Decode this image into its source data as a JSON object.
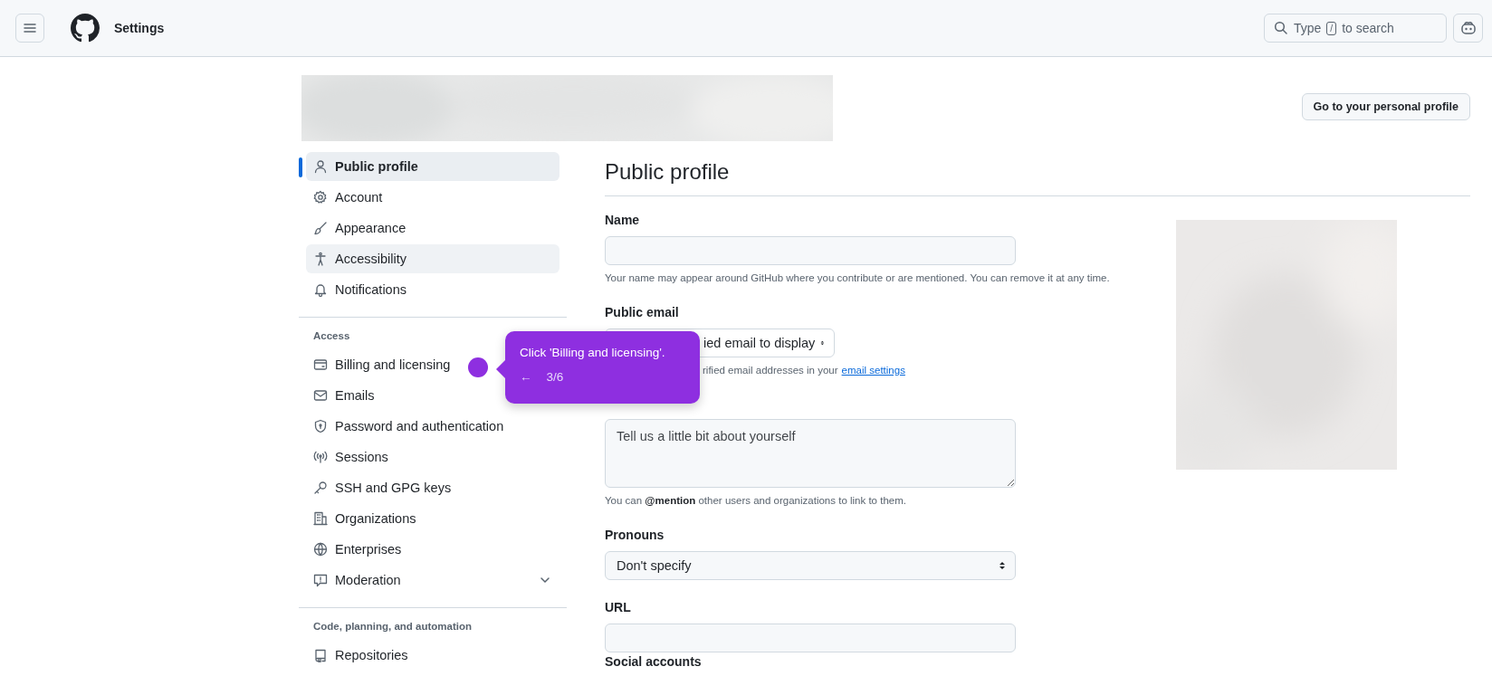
{
  "header": {
    "title": "Settings",
    "search": {
      "before": "Type",
      "key": "/",
      "after": "to search"
    }
  },
  "profile_button": "Go to your personal profile",
  "sidebar": {
    "sections": [
      {
        "items": [
          {
            "label": "Public profile",
            "selected": true,
            "hovered": false
          },
          {
            "label": "Account",
            "selected": false,
            "hovered": false
          },
          {
            "label": "Appearance",
            "selected": false,
            "hovered": false
          },
          {
            "label": "Accessibility",
            "selected": false,
            "hovered": true
          },
          {
            "label": "Notifications",
            "selected": false,
            "hovered": false
          }
        ]
      },
      {
        "heading": "Access",
        "items": [
          {
            "label": "Billing and licensing",
            "selected": false,
            "hovered": false
          },
          {
            "label": "Emails",
            "selected": false,
            "hovered": false
          },
          {
            "label": "Password and authentication",
            "selected": false,
            "hovered": false
          },
          {
            "label": "Sessions",
            "selected": false,
            "hovered": false
          },
          {
            "label": "SSH and GPG keys",
            "selected": false,
            "hovered": false
          },
          {
            "label": "Organizations",
            "selected": false,
            "hovered": false
          },
          {
            "label": "Enterprises",
            "selected": false,
            "hovered": false
          },
          {
            "label": "Moderation",
            "selected": false,
            "hovered": false,
            "expanded": false
          }
        ]
      },
      {
        "heading": "Code, planning, and automation",
        "items": [
          {
            "label": "Repositories",
            "selected": false,
            "hovered": false
          }
        ]
      }
    ]
  },
  "main": {
    "title": "Public profile",
    "name": {
      "label": "Name",
      "hint": "Your name may appear around GitHub where you contribute or are mentioned. You can remove it at any time."
    },
    "public_email": {
      "label": "Public email",
      "value": "ied email to display",
      "hint": "rified email addresses in your",
      "link": "email settings"
    },
    "bio": {
      "placeholder": "Tell us a little bit about yourself",
      "hint": "You can **@mention** other users and organizations to link to them."
    },
    "pronouns": {
      "label": "Pronouns",
      "value": "Don't specify"
    },
    "url": {
      "label": "URL"
    },
    "social": {
      "label": "Social accounts"
    }
  },
  "tooltip": {
    "text": "Click 'Billing and licensing'.",
    "back": "←",
    "step": "3/6"
  }
}
